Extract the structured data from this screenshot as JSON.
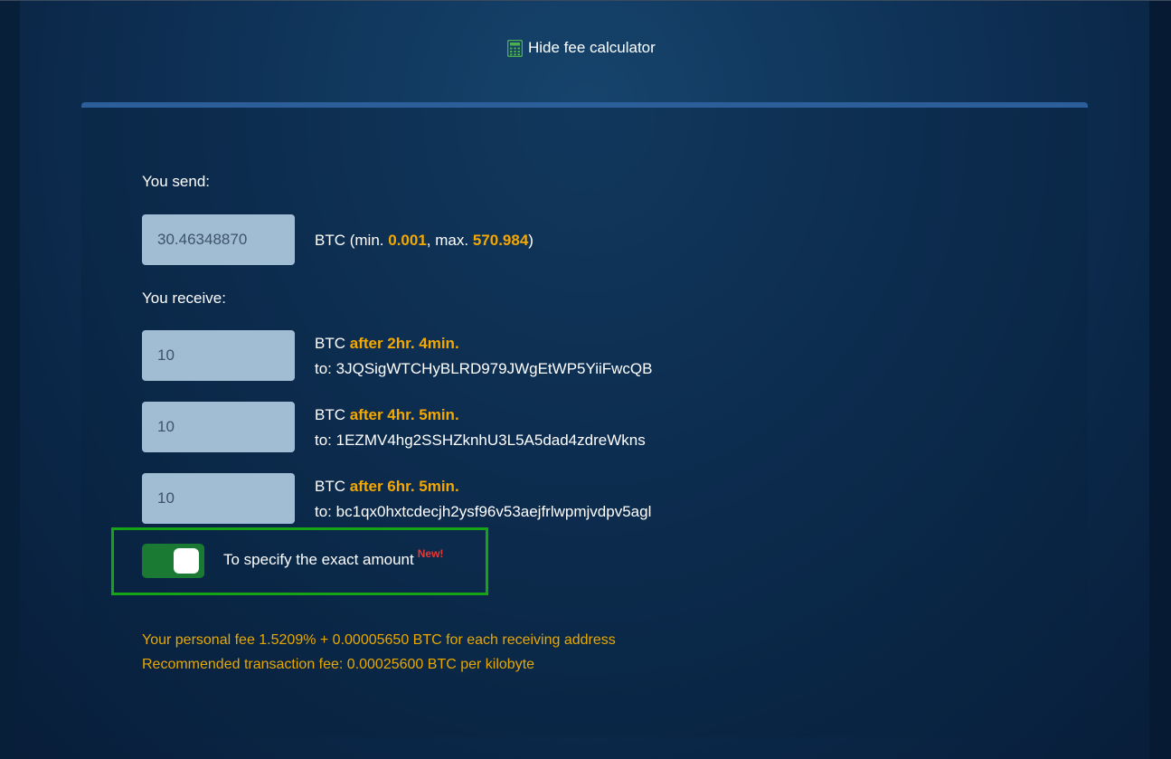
{
  "header": {
    "toggle_label": "Hide fee calculator",
    "toggle_icon": "calculator-icon",
    "icon_color": "#4caf50"
  },
  "send": {
    "label": "You send:",
    "amount": "30.46348870",
    "currency": "BTC",
    "range_prefix": "(min.",
    "min": "0.001",
    "max_prefix": ", max.",
    "max": "570.984",
    "range_suffix": ")"
  },
  "receive": {
    "label": "You receive:",
    "rows": [
      {
        "amount": "10",
        "currency": "BTC",
        "delay": "after 2hr. 4min.",
        "to_prefix": "to:",
        "address": "3JQSigWTCHyBLRD979JWgEtWP5YiiFwcQB"
      },
      {
        "amount": "10",
        "currency": "BTC",
        "delay": "after 4hr. 5min.",
        "to_prefix": "to:",
        "address": "1EZMV4hg2SSHZknhU3L5A5dad4zdreWkns"
      },
      {
        "amount": "10",
        "currency": "BTC",
        "delay": "after 6hr. 5min.",
        "to_prefix": "to:",
        "address": "bc1qx0hxtcdecjh2ysf96v53aejfrlwpmjvdpv5agl"
      }
    ]
  },
  "exact_amount": {
    "label": "To specify the exact amount",
    "badge": "New!",
    "enabled": true
  },
  "fees": {
    "personal_fee": "Your personal fee 1.5209% + 0.00005650 BTC for each receiving address",
    "recommended_fee": "Recommended transaction fee: 0.00025600 BTC per kilobyte"
  },
  "colors": {
    "accent": "#f5a800",
    "switch_on": "#1a7a33",
    "highlight": "#16a316",
    "badge": "#e53935"
  }
}
